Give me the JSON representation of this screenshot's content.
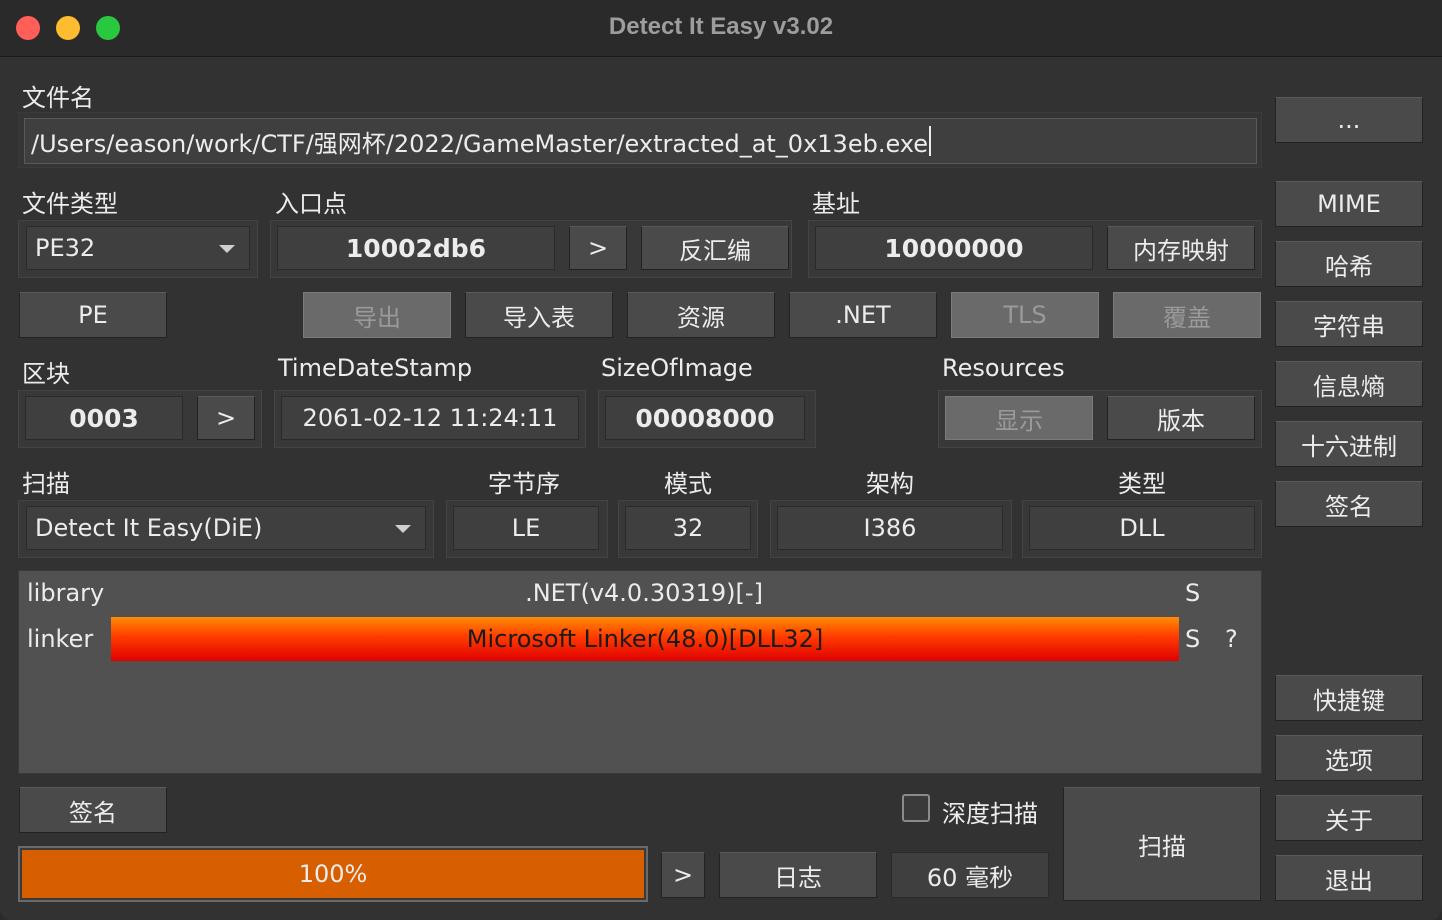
{
  "window": {
    "title": "Detect It Easy v3.02"
  },
  "file": {
    "label": "文件名",
    "path": "/Users/eason/work/CTF/强网杯/2022/GameMaster/extracted_at_0x13eb.exe",
    "browse_label": "..."
  },
  "filetype": {
    "label": "文件类型",
    "value": "PE32"
  },
  "entry": {
    "label": "入口点",
    "value": "10002db6",
    "go_label": ">",
    "disasm_label": "反汇编"
  },
  "base": {
    "label": "基址",
    "value": "10000000",
    "memmap_label": "内存映射"
  },
  "sections_row": {
    "pe": "PE",
    "export": "导出",
    "import": "导入表",
    "resources": "资源",
    "net": ".NET",
    "tls": "TLS",
    "overlay": "覆盖"
  },
  "section": {
    "label": "区块",
    "value": "0003",
    "go_label": ">"
  },
  "timestamp": {
    "label": "TimeDateStamp",
    "value": "2061-02-12 11:24:11"
  },
  "sizeofimage": {
    "label": "SizeOfImage",
    "value": "00008000"
  },
  "resources": {
    "label": "Resources",
    "show_label": "显示",
    "version_label": "版本"
  },
  "scan": {
    "label": "扫描",
    "engine": "Detect It Easy(DiE)"
  },
  "endian": {
    "label": "字节序",
    "value": "LE"
  },
  "mode": {
    "label": "模式",
    "value": "32"
  },
  "arch": {
    "label": "架构",
    "value": "I386"
  },
  "type": {
    "label": "类型",
    "value": "DLL"
  },
  "results": [
    {
      "kind": "library",
      "name": ".NET(v4.0.30319)[-]",
      "flag": "S",
      "extra": "",
      "highlight": false
    },
    {
      "kind": "linker",
      "name": "Microsoft Linker(48.0)[DLL32]",
      "flag": "S",
      "extra": "?",
      "highlight": true
    }
  ],
  "bottom": {
    "signature_label": "签名",
    "deep_scan_label": "深度扫描",
    "deep_scan_checked": false,
    "scan_label": "扫描",
    "progress_text": "100%",
    "progress_value": 1.0,
    "go_label": ">",
    "log_label": "日志",
    "time_label": "60 毫秒"
  },
  "right_panel": {
    "mime": "MIME",
    "hash": "哈希",
    "strings": "字符串",
    "entropy": "信息熵",
    "hex": "十六进制",
    "signatures": "签名",
    "shortcuts": "快捷键",
    "options": "选项",
    "about": "关于",
    "exit": "退出"
  },
  "colors": {
    "traffic_close": "#ff5f57",
    "traffic_min": "#febc2e",
    "traffic_max": "#28c840",
    "progress_fill": "#d85f00",
    "highlight_bar_top": "#ff8c00",
    "highlight_bar_bottom": "#e00000"
  }
}
